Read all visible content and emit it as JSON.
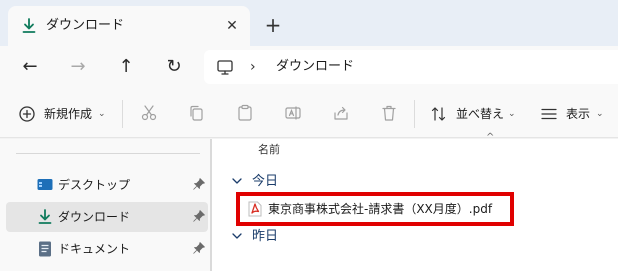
{
  "window": {
    "tab_title": "ダウンロード",
    "tab_close": "✕",
    "new_tab": "+"
  },
  "nav": {
    "back_icon": "arrow-left-icon",
    "forward_icon": "arrow-right-icon",
    "up_icon": "arrow-up-icon",
    "refresh_icon": "refresh-icon",
    "back": "←",
    "forward": "→",
    "up": "↑",
    "refresh": "↻"
  },
  "address": {
    "separator": "›",
    "crumb": "ダウンロード"
  },
  "toolbar": {
    "new_label": "新規作成",
    "sort_label": "並べ替え",
    "view_label": "表示",
    "caret": "⌄"
  },
  "sidebar": {
    "items": [
      {
        "label": "デスクトップ",
        "icon": "desktop-icon",
        "pinned": true,
        "selected": false
      },
      {
        "label": "ダウンロード",
        "icon": "download-icon",
        "pinned": true,
        "selected": true
      },
      {
        "label": "ドキュメント",
        "icon": "document-icon",
        "pinned": true,
        "selected": false
      }
    ]
  },
  "content": {
    "column_name": "名前",
    "sort_indicator": "^",
    "groups": [
      {
        "label": "今日",
        "files": [
          {
            "name": "東京商事株式会社-請求書（XX月度）.pdf",
            "icon": "pdf-icon",
            "highlighted": true
          }
        ]
      },
      {
        "label": "昨日",
        "files": []
      }
    ]
  },
  "colors": {
    "accent": "#0f7b5c",
    "highlight_border": "#e00000",
    "pdf_red": "#d93025",
    "group_label": "#1b3d6b"
  }
}
